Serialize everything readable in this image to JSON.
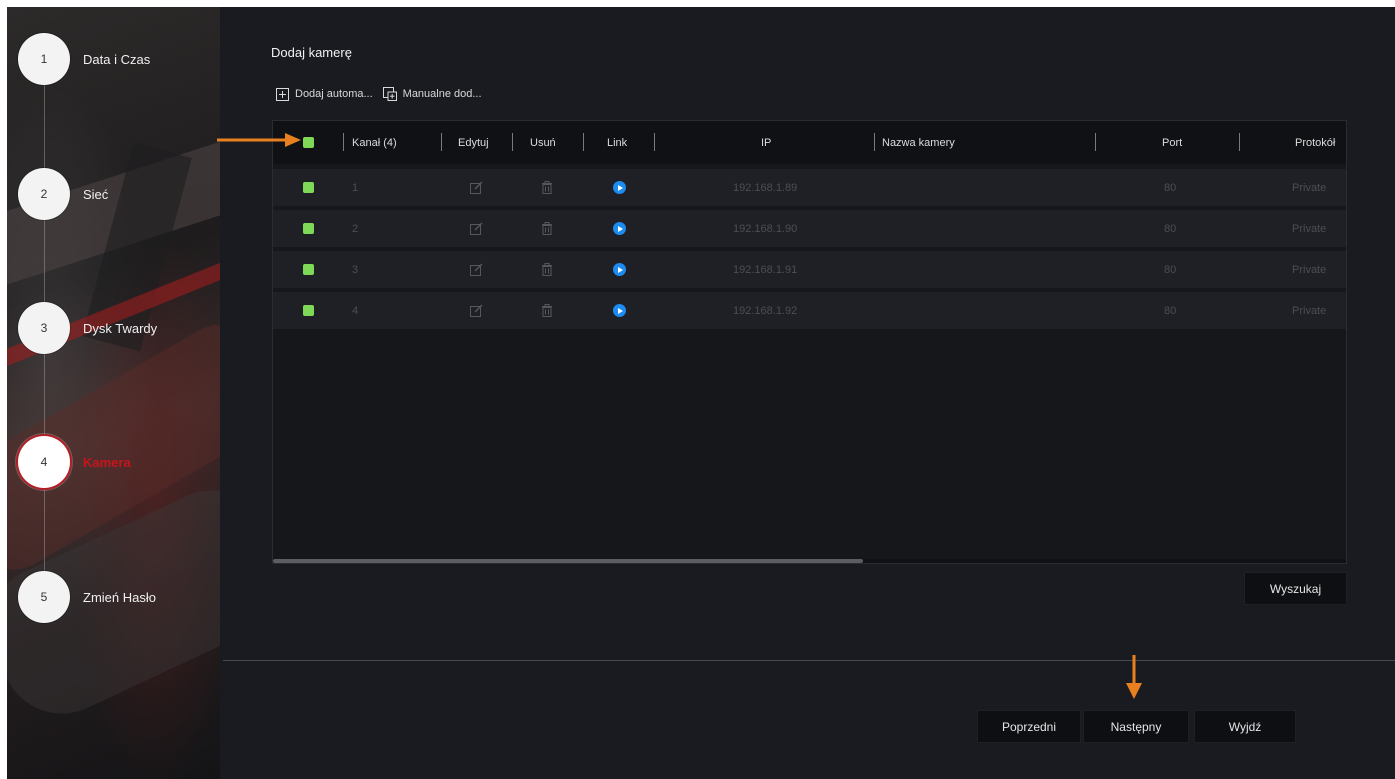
{
  "steps": [
    {
      "number": "1",
      "label": "Data i Czas"
    },
    {
      "number": "2",
      "label": "Sieć"
    },
    {
      "number": "3",
      "label": "Dysk Twardy"
    },
    {
      "number": "4",
      "label": "Kamera"
    },
    {
      "number": "5",
      "label": "Zmień Hasło"
    }
  ],
  "active_step": "4",
  "header": {
    "title": "Dodaj kamerę"
  },
  "toolbar": {
    "auto_add": {
      "label": "Dodaj automa...",
      "icon": "add-box-icon"
    },
    "manual_add": {
      "label": "Manualne dod...",
      "icon": "manual-add-icon"
    }
  },
  "table": {
    "columns": {
      "select": "",
      "channel": "Kanał (4)",
      "edit": "Edytuj",
      "delete": "Usuń",
      "link": "Link",
      "ip": "IP",
      "name": "Nazwa kamery",
      "port": "Port",
      "protocol": "Protokół"
    },
    "rows": [
      {
        "channel": "1",
        "ip": "192.168.1.89",
        "name": "",
        "port": "80",
        "protocol": "Private"
      },
      {
        "channel": "2",
        "ip": "192.168.1.90",
        "name": "",
        "port": "80",
        "protocol": "Private"
      },
      {
        "channel": "3",
        "ip": "192.168.1.91",
        "name": "",
        "port": "80",
        "protocol": "Private"
      },
      {
        "channel": "4",
        "ip": "192.168.1.92",
        "name": "",
        "port": "80",
        "protocol": "Private"
      }
    ],
    "scroll_fraction": 0.55
  },
  "buttons": {
    "search": "Wyszukaj",
    "prev": "Poprzedni",
    "next": "Następny",
    "exit": "Wyjdź"
  },
  "colors": {
    "accent_red": "#c8141c",
    "checkbox_green": "#7ed957",
    "link_blue": "#1d8cf0",
    "annotation_orange": "#e8801f"
  }
}
